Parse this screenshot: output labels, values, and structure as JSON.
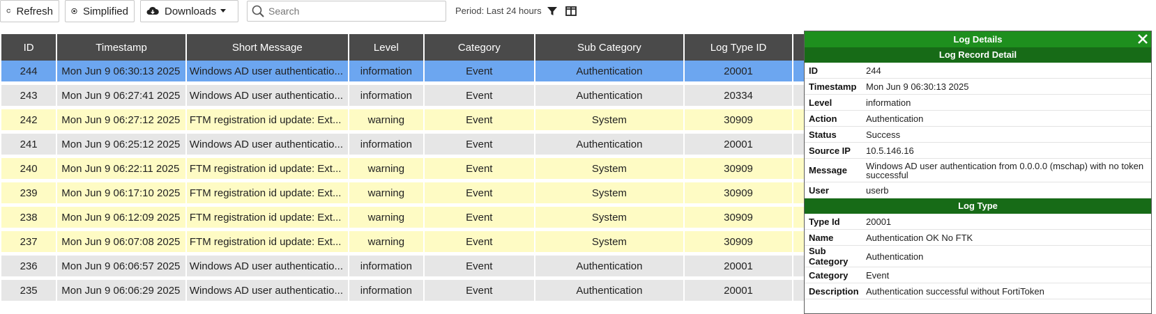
{
  "toolbar": {
    "refresh_label": "Refresh",
    "simplified_label": "Simplified",
    "downloads_label": "Downloads",
    "search_placeholder": "Search",
    "period_label": "Period: Last 24 hours"
  },
  "table": {
    "columns": [
      "ID",
      "Timestamp",
      "Short Message",
      "Level",
      "Category",
      "Sub Category",
      "Log Type ID"
    ],
    "rows": [
      {
        "id": "244",
        "timestamp": "Mon Jun 9 06:30:13 2025",
        "message": "Windows AD user authenticatio...",
        "level": "information",
        "category": "Event",
        "sub_category": "Authentication",
        "log_type_id": "20001"
      },
      {
        "id": "243",
        "timestamp": "Mon Jun 9 06:27:41 2025",
        "message": "Windows AD user authenticatio...",
        "level": "information",
        "category": "Event",
        "sub_category": "Authentication",
        "log_type_id": "20334"
      },
      {
        "id": "242",
        "timestamp": "Mon Jun 9 06:27:12 2025",
        "message": "FTM registration id update: Ext...",
        "level": "warning",
        "category": "Event",
        "sub_category": "System",
        "log_type_id": "30909"
      },
      {
        "id": "241",
        "timestamp": "Mon Jun 9 06:25:12 2025",
        "message": "Windows AD user authenticatio...",
        "level": "information",
        "category": "Event",
        "sub_category": "Authentication",
        "log_type_id": "20001"
      },
      {
        "id": "240",
        "timestamp": "Mon Jun 9 06:22:11 2025",
        "message": "FTM registration id update: Ext...",
        "level": "warning",
        "category": "Event",
        "sub_category": "System",
        "log_type_id": "30909"
      },
      {
        "id": "239",
        "timestamp": "Mon Jun 9 06:17:10 2025",
        "message": "FTM registration id update: Ext...",
        "level": "warning",
        "category": "Event",
        "sub_category": "System",
        "log_type_id": "30909"
      },
      {
        "id": "238",
        "timestamp": "Mon Jun 9 06:12:09 2025",
        "message": "FTM registration id update: Ext...",
        "level": "warning",
        "category": "Event",
        "sub_category": "System",
        "log_type_id": "30909"
      },
      {
        "id": "237",
        "timestamp": "Mon Jun 9 06:07:08 2025",
        "message": "FTM registration id update: Ext...",
        "level": "warning",
        "category": "Event",
        "sub_category": "System",
        "log_type_id": "30909"
      },
      {
        "id": "236",
        "timestamp": "Mon Jun 9 06:06:57 2025",
        "message": "Windows AD user authenticatio...",
        "level": "information",
        "category": "Event",
        "sub_category": "Authentication",
        "log_type_id": "20001"
      },
      {
        "id": "235",
        "timestamp": "Mon Jun 9 06:06:29 2025",
        "message": "Windows AD user authenticatio...",
        "level": "information",
        "category": "Event",
        "sub_category": "Authentication",
        "log_type_id": "20001"
      }
    ]
  },
  "details": {
    "title": "Log Details",
    "record_section": "Log Record Detail",
    "record": [
      {
        "key": "ID",
        "value": "244"
      },
      {
        "key": "Timestamp",
        "value": "Mon Jun 9 06:30:13 2025"
      },
      {
        "key": "Level",
        "value": "information"
      },
      {
        "key": "Action",
        "value": "Authentication"
      },
      {
        "key": "Status",
        "value": "Success"
      },
      {
        "key": "Source IP",
        "value": "10.5.146.16"
      },
      {
        "key": "Message",
        "value": "Windows AD user authentication from 0.0.0.0 (mschap) with no token successful"
      },
      {
        "key": "User",
        "value": "userb"
      }
    ],
    "type_section": "Log Type",
    "type": [
      {
        "key": "Type Id",
        "value": "20001"
      },
      {
        "key": "Name",
        "value": "Authentication OK No FTK"
      },
      {
        "key": "Sub Category",
        "value": "Authentication"
      },
      {
        "key": "Category",
        "value": "Event"
      },
      {
        "key": "Description",
        "value": "Authentication successful without FortiToken"
      }
    ]
  },
  "colors": {
    "header_bg": "#4a4a4a",
    "selected_row": "#6ca6f0",
    "info_row": "#e6e6e6",
    "warning_row": "#fefbc4",
    "panel_title": "#1e8f1e",
    "panel_section": "#176b17"
  },
  "icons": {
    "refresh": "refresh-icon",
    "simplified": "eye-icon",
    "downloads": "cloud-download-icon",
    "search": "search-icon",
    "filter": "filter-icon",
    "columns": "columns-icon",
    "close": "close-icon"
  }
}
